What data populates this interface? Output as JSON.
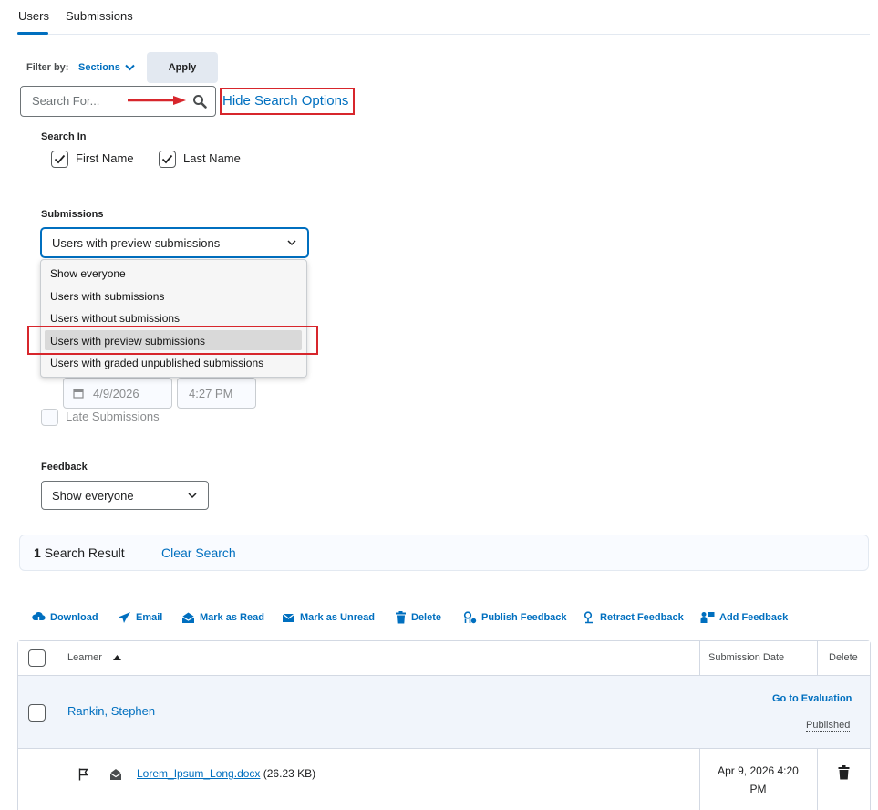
{
  "tabs": [
    {
      "label": "Users",
      "selected": true
    },
    {
      "label": "Submissions",
      "selected": false
    }
  ],
  "filter": {
    "label": "Filter by:",
    "sections_label": "Sections",
    "apply_label": "Apply"
  },
  "search": {
    "placeholder": "Search For...",
    "hide_options_label": "Hide Search Options"
  },
  "search_in": {
    "label": "Search In",
    "first_name": {
      "label": "First Name",
      "checked": true
    },
    "last_name": {
      "label": "Last Name",
      "checked": true
    }
  },
  "submissions": {
    "label": "Submissions",
    "selected": "Users with preview submissions",
    "options": [
      "Show everyone",
      "Users with submissions",
      "Users without submissions",
      "Users with preview submissions",
      "Users with graded unpublished submissions"
    ],
    "date": "4/9/2026",
    "time": "4:27 PM",
    "late_label": "Late Submissions"
  },
  "feedback": {
    "label": "Feedback",
    "selected": "Show everyone"
  },
  "results": {
    "count": "1",
    "count_suffix": "Search Result",
    "clear_label": "Clear Search"
  },
  "actions": {
    "download": "Download",
    "email": "Email",
    "mark_read": "Mark as Read",
    "mark_unread": "Mark as Unread",
    "delete": "Delete",
    "publish_feedback": "Publish Feedback",
    "retract_feedback": "Retract Feedback",
    "add_feedback": "Add Feedback"
  },
  "table": {
    "col_learner": "Learner",
    "col_submission_date": "Submission Date",
    "col_delete": "Delete",
    "rows": [
      {
        "learner": "Rankin, Stephen",
        "go_to_eval": "Go to Evaluation",
        "status": "Published",
        "file_name": "Lorem_Ipsum_Long.docx",
        "file_size": "(26.23 KB)",
        "date_line1": "Apr 9, 2026 4:20",
        "date_line2": "PM"
      }
    ]
  },
  "colors": {
    "link": "#006fbf",
    "highlight_box": "#d7262c",
    "arrow": "#d7262c"
  }
}
